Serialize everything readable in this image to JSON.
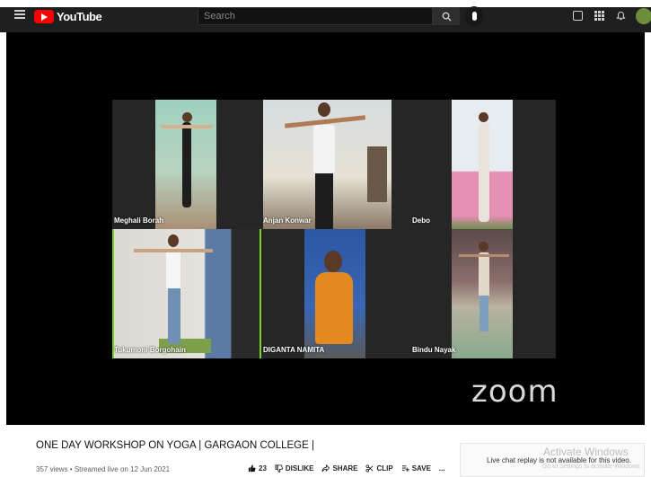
{
  "header": {
    "logo_text": "YouTube",
    "search_placeholder": "Search"
  },
  "meeting": {
    "participants": [
      {
        "name": "Meghali Borah"
      },
      {
        "name": "Anjan Konwar"
      },
      {
        "name": "Debo"
      },
      {
        "name": "Tukumoni Borgohain",
        "active_speaker": true
      },
      {
        "name": "DIGANTA NAMITA"
      },
      {
        "name": "Bindu Nayak"
      }
    ],
    "watermark": "zoom",
    "active_border_color": "#7ed321"
  },
  "video": {
    "title": "ONE DAY WORKSHOP ON YOGA | GARGAON COLLEGE |",
    "meta": "357 views • Streamed live on 12 Jun 2021",
    "actions": {
      "likes": "23",
      "dislike": "DISLIKE",
      "share": "SHARE",
      "clip": "CLIP",
      "save": "SAVE",
      "more": "..."
    }
  },
  "chat": {
    "message": "Live chat replay is not available for this video."
  },
  "os_watermark": {
    "title": "Activate Windows",
    "subtitle": "Go to Settings to activate Windows."
  }
}
